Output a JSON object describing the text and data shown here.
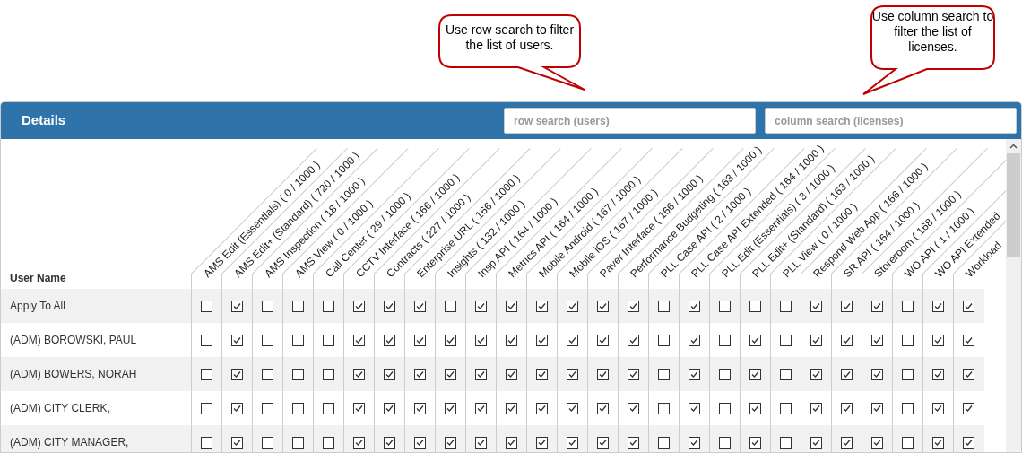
{
  "callouts": [
    {
      "text": "Use row search to filter the list of users."
    },
    {
      "text": "Use column search to filter the list of licenses."
    }
  ],
  "panel": {
    "title": "Details",
    "row_search": {
      "placeholder": "row search (users)"
    },
    "column_search": {
      "placeholder": "column search (licenses)"
    }
  },
  "table": {
    "name_header": "User Name",
    "columns": [
      "AMS Edit (Essentials) ( 0 / 1000 )",
      "AMS Edit+ (Standard) ( 720 / 1000 )",
      "AMS Inspection ( 18 / 1000 )",
      "AMS View ( 0 / 1000 )",
      "Call Center ( 29 / 1000 )",
      "CCTV Interface ( 166 / 1000 )",
      "Contracts ( 227 / 1000 )",
      "Enterprise URL ( 166 / 1000 )",
      "Insights ( 132 / 1000 )",
      "Insp API ( 164 / 1000 )",
      "Metrics API ( 164 / 1000 )",
      "Mobile Android ( 167 / 1000 )",
      "Mobile iOS ( 167 / 1000 )",
      "Paver Interface ( 166 / 1000 )",
      "Performance Budgeting ( 163 / 1000 )",
      "PLL Case API ( 2 / 1000 )",
      "PLL Case API Extended ( 164 / 1000 )",
      "PLL Edit (Essentials) ( 3 / 1000 )",
      "PLL Edit+ (Standard) ( 163 / 1000 )",
      "PLL View ( 0 / 1000 )",
      "Respond Web App ( 166 / 1000 )",
      "SR API ( 164 / 1000 )",
      "Storeroom ( 168 / 1000 )",
      "WO API ( 1 / 1000 )",
      "WO API Extended",
      "Workload"
    ],
    "rows": [
      {
        "name": "Apply To All",
        "checked": [
          false,
          true,
          false,
          false,
          false,
          true,
          true,
          true,
          false,
          true,
          true,
          true,
          true,
          true,
          true,
          false,
          true,
          false,
          false,
          false,
          true,
          true,
          true,
          false,
          true,
          true
        ]
      },
      {
        "name": "(ADM) BOROWSKI, PAUL",
        "checked": [
          false,
          true,
          false,
          false,
          false,
          true,
          true,
          true,
          true,
          true,
          true,
          true,
          true,
          true,
          true,
          false,
          true,
          false,
          true,
          false,
          true,
          true,
          true,
          false,
          true,
          true
        ]
      },
      {
        "name": "(ADM) BOWERS, NORAH",
        "checked": [
          false,
          true,
          false,
          false,
          false,
          true,
          true,
          true,
          true,
          true,
          true,
          true,
          true,
          true,
          true,
          false,
          true,
          false,
          true,
          false,
          true,
          true,
          true,
          false,
          true,
          true
        ]
      },
      {
        "name": "(ADM) CITY CLERK,",
        "checked": [
          false,
          true,
          false,
          false,
          false,
          true,
          true,
          true,
          true,
          true,
          true,
          true,
          true,
          true,
          true,
          false,
          true,
          false,
          true,
          false,
          true,
          true,
          true,
          false,
          true,
          true
        ]
      },
      {
        "name": "(ADM) CITY MANAGER,",
        "checked": [
          false,
          true,
          false,
          false,
          false,
          true,
          true,
          true,
          true,
          true,
          true,
          true,
          true,
          true,
          true,
          false,
          true,
          false,
          true,
          false,
          true,
          true,
          true,
          false,
          true,
          true
        ]
      }
    ]
  }
}
